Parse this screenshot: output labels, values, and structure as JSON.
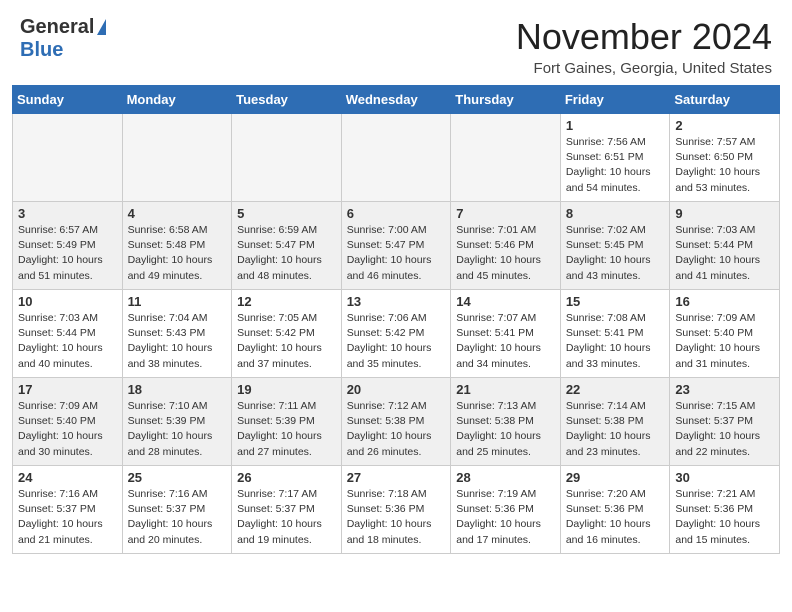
{
  "logo": {
    "line1": "General",
    "line2": "Blue",
    "triangle": "▲"
  },
  "header": {
    "month": "November 2024",
    "location": "Fort Gaines, Georgia, United States"
  },
  "days_of_week": [
    "Sunday",
    "Monday",
    "Tuesday",
    "Wednesday",
    "Thursday",
    "Friday",
    "Saturday"
  ],
  "weeks": [
    [
      {
        "day": "",
        "info": "",
        "empty": true
      },
      {
        "day": "",
        "info": "",
        "empty": true
      },
      {
        "day": "",
        "info": "",
        "empty": true
      },
      {
        "day": "",
        "info": "",
        "empty": true
      },
      {
        "day": "",
        "info": "",
        "empty": true
      },
      {
        "day": "1",
        "info": "Sunrise: 7:56 AM\nSunset: 6:51 PM\nDaylight: 10 hours\nand 54 minutes.",
        "empty": false
      },
      {
        "day": "2",
        "info": "Sunrise: 7:57 AM\nSunset: 6:50 PM\nDaylight: 10 hours\nand 53 minutes.",
        "empty": false
      }
    ],
    [
      {
        "day": "3",
        "info": "Sunrise: 6:57 AM\nSunset: 5:49 PM\nDaylight: 10 hours\nand 51 minutes.",
        "empty": false
      },
      {
        "day": "4",
        "info": "Sunrise: 6:58 AM\nSunset: 5:48 PM\nDaylight: 10 hours\nand 49 minutes.",
        "empty": false
      },
      {
        "day": "5",
        "info": "Sunrise: 6:59 AM\nSunset: 5:47 PM\nDaylight: 10 hours\nand 48 minutes.",
        "empty": false
      },
      {
        "day": "6",
        "info": "Sunrise: 7:00 AM\nSunset: 5:47 PM\nDaylight: 10 hours\nand 46 minutes.",
        "empty": false
      },
      {
        "day": "7",
        "info": "Sunrise: 7:01 AM\nSunset: 5:46 PM\nDaylight: 10 hours\nand 45 minutes.",
        "empty": false
      },
      {
        "day": "8",
        "info": "Sunrise: 7:02 AM\nSunset: 5:45 PM\nDaylight: 10 hours\nand 43 minutes.",
        "empty": false
      },
      {
        "day": "9",
        "info": "Sunrise: 7:03 AM\nSunset: 5:44 PM\nDaylight: 10 hours\nand 41 minutes.",
        "empty": false
      }
    ],
    [
      {
        "day": "10",
        "info": "Sunrise: 7:03 AM\nSunset: 5:44 PM\nDaylight: 10 hours\nand 40 minutes.",
        "empty": false
      },
      {
        "day": "11",
        "info": "Sunrise: 7:04 AM\nSunset: 5:43 PM\nDaylight: 10 hours\nand 38 minutes.",
        "empty": false
      },
      {
        "day": "12",
        "info": "Sunrise: 7:05 AM\nSunset: 5:42 PM\nDaylight: 10 hours\nand 37 minutes.",
        "empty": false
      },
      {
        "day": "13",
        "info": "Sunrise: 7:06 AM\nSunset: 5:42 PM\nDaylight: 10 hours\nand 35 minutes.",
        "empty": false
      },
      {
        "day": "14",
        "info": "Sunrise: 7:07 AM\nSunset: 5:41 PM\nDaylight: 10 hours\nand 34 minutes.",
        "empty": false
      },
      {
        "day": "15",
        "info": "Sunrise: 7:08 AM\nSunset: 5:41 PM\nDaylight: 10 hours\nand 33 minutes.",
        "empty": false
      },
      {
        "day": "16",
        "info": "Sunrise: 7:09 AM\nSunset: 5:40 PM\nDaylight: 10 hours\nand 31 minutes.",
        "empty": false
      }
    ],
    [
      {
        "day": "17",
        "info": "Sunrise: 7:09 AM\nSunset: 5:40 PM\nDaylight: 10 hours\nand 30 minutes.",
        "empty": false
      },
      {
        "day": "18",
        "info": "Sunrise: 7:10 AM\nSunset: 5:39 PM\nDaylight: 10 hours\nand 28 minutes.",
        "empty": false
      },
      {
        "day": "19",
        "info": "Sunrise: 7:11 AM\nSunset: 5:39 PM\nDaylight: 10 hours\nand 27 minutes.",
        "empty": false
      },
      {
        "day": "20",
        "info": "Sunrise: 7:12 AM\nSunset: 5:38 PM\nDaylight: 10 hours\nand 26 minutes.",
        "empty": false
      },
      {
        "day": "21",
        "info": "Sunrise: 7:13 AM\nSunset: 5:38 PM\nDaylight: 10 hours\nand 25 minutes.",
        "empty": false
      },
      {
        "day": "22",
        "info": "Sunrise: 7:14 AM\nSunset: 5:38 PM\nDaylight: 10 hours\nand 23 minutes.",
        "empty": false
      },
      {
        "day": "23",
        "info": "Sunrise: 7:15 AM\nSunset: 5:37 PM\nDaylight: 10 hours\nand 22 minutes.",
        "empty": false
      }
    ],
    [
      {
        "day": "24",
        "info": "Sunrise: 7:16 AM\nSunset: 5:37 PM\nDaylight: 10 hours\nand 21 minutes.",
        "empty": false
      },
      {
        "day": "25",
        "info": "Sunrise: 7:16 AM\nSunset: 5:37 PM\nDaylight: 10 hours\nand 20 minutes.",
        "empty": false
      },
      {
        "day": "26",
        "info": "Sunrise: 7:17 AM\nSunset: 5:37 PM\nDaylight: 10 hours\nand 19 minutes.",
        "empty": false
      },
      {
        "day": "27",
        "info": "Sunrise: 7:18 AM\nSunset: 5:36 PM\nDaylight: 10 hours\nand 18 minutes.",
        "empty": false
      },
      {
        "day": "28",
        "info": "Sunrise: 7:19 AM\nSunset: 5:36 PM\nDaylight: 10 hours\nand 17 minutes.",
        "empty": false
      },
      {
        "day": "29",
        "info": "Sunrise: 7:20 AM\nSunset: 5:36 PM\nDaylight: 10 hours\nand 16 minutes.",
        "empty": false
      },
      {
        "day": "30",
        "info": "Sunrise: 7:21 AM\nSunset: 5:36 PM\nDaylight: 10 hours\nand 15 minutes.",
        "empty": false
      }
    ]
  ]
}
